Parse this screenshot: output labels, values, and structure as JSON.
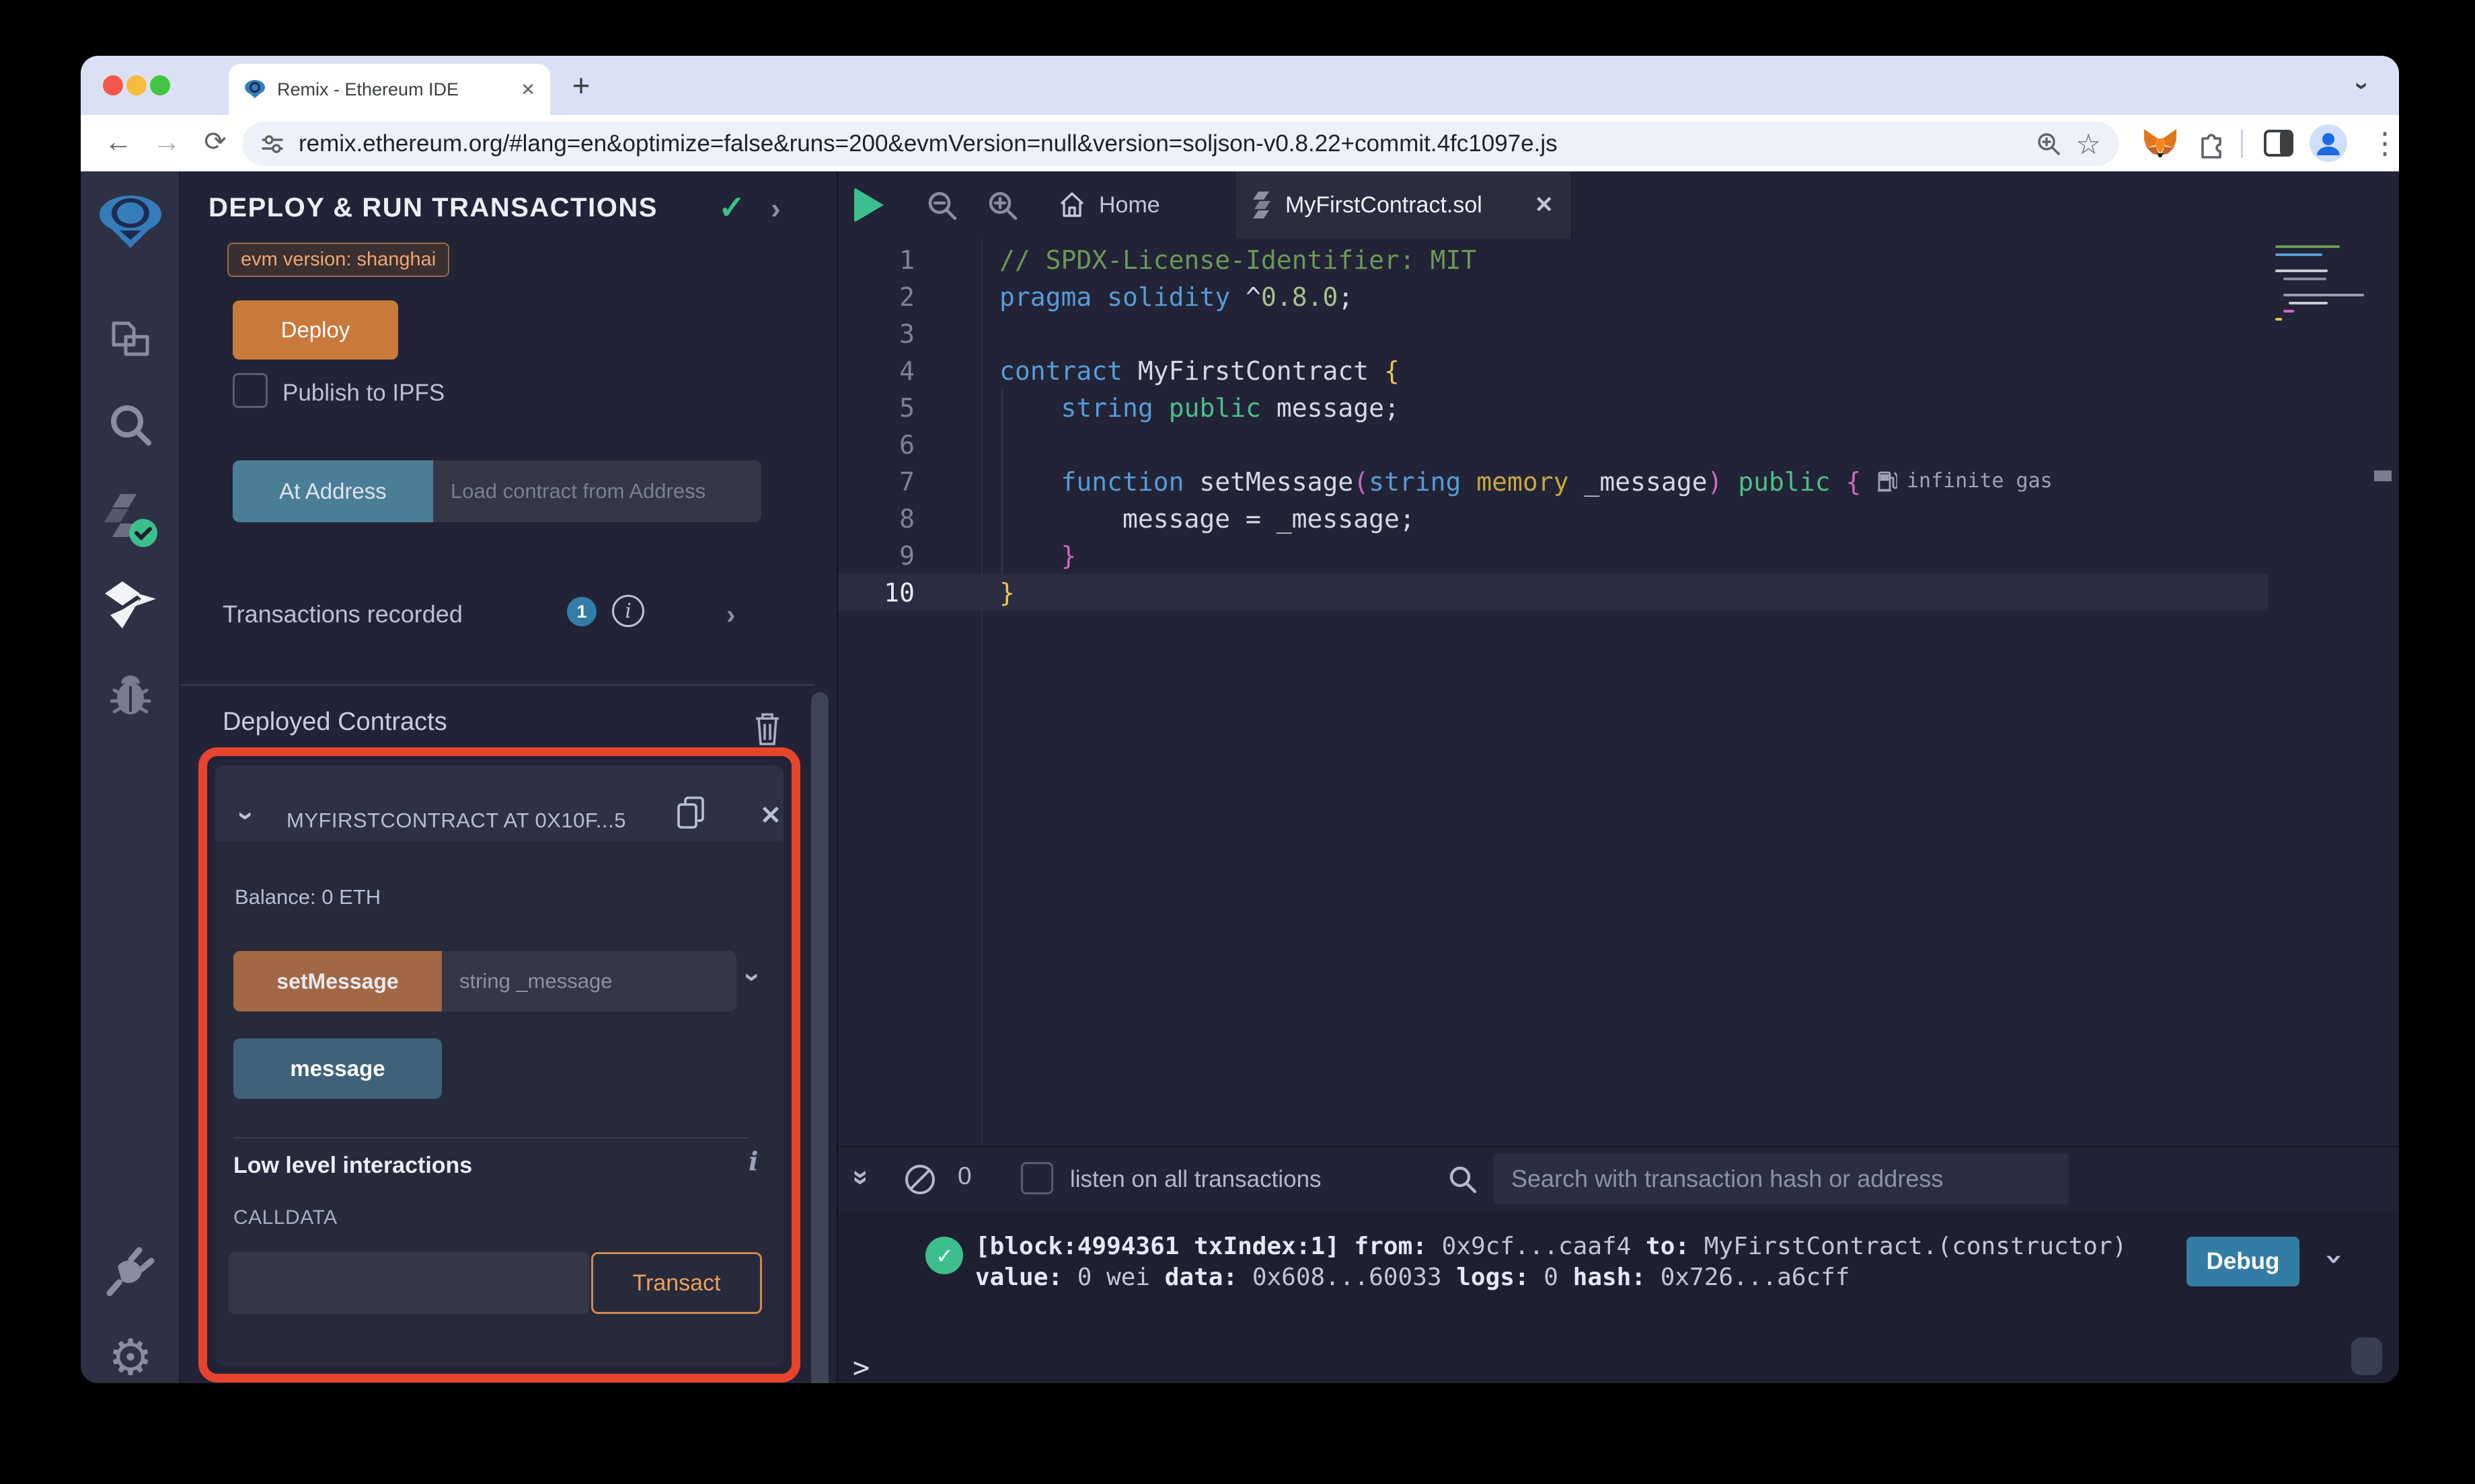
{
  "browser": {
    "tab_title": "Remix - Ethereum IDE",
    "url": "remix.ethereum.org/#lang=en&optimize=false&runs=200&evmVersion=null&version=soljson-v0.8.22+commit.4fc1097e.js"
  },
  "icons": {
    "close": "✕",
    "plus": "+",
    "kebab": "⋮",
    "chevron": "›",
    "double_chevron": "»",
    "back": "←",
    "forward": "→",
    "reload": "⟳",
    "check": "✓",
    "info": "i",
    "star": "☆",
    "gear": "⚙"
  },
  "side_panel": {
    "title": "DEPLOY & RUN TRANSACTIONS",
    "evm_badge": "evm version: shanghai",
    "deploy_button": "Deploy",
    "publish_checkbox_label": "Publish to IPFS",
    "at_address_button": "At Address",
    "at_address_placeholder": "Load contract from Address",
    "transactions_recorded_label": "Transactions recorded",
    "transactions_count": "1",
    "deployed_contracts_label": "Deployed Contracts",
    "contract_card": {
      "title": "MYFIRSTCONTRACT AT 0X10F...5",
      "balance": "Balance: 0 ETH",
      "set_message_button": "setMessage",
      "set_message_placeholder": "string _message",
      "message_button": "message",
      "low_level_label": "Low level interactions",
      "calldata_label": "CALLDATA",
      "transact_button": "Transact"
    }
  },
  "editor": {
    "tabs": [
      {
        "label": "Home"
      },
      {
        "label": "MyFirstContract.sol"
      }
    ],
    "gas_annotation": "infinite gas",
    "lines": [
      {
        "n": "1",
        "tokens": [
          [
            "comment",
            "// SPDX-License-Identifier: MIT"
          ]
        ]
      },
      {
        "n": "2",
        "tokens": [
          [
            "keyword",
            "pragma"
          ],
          [
            "plain",
            " "
          ],
          [
            "keyword",
            "solidity"
          ],
          [
            "plain",
            " ^"
          ],
          [
            "number",
            "0.8.0"
          ],
          [
            "plain",
            ";"
          ]
        ]
      },
      {
        "n": "3",
        "tokens": []
      },
      {
        "n": "4",
        "tokens": [
          [
            "keyword",
            "contract"
          ],
          [
            "plain",
            " MyFirstContract "
          ],
          [
            "yellow",
            "{"
          ]
        ]
      },
      {
        "n": "5",
        "tokens": [
          [
            "plain",
            "    "
          ],
          [
            "keyword",
            "string"
          ],
          [
            "plain",
            " "
          ],
          [
            "green",
            "public"
          ],
          [
            "plain",
            " message;"
          ]
        ]
      },
      {
        "n": "6",
        "tokens": []
      },
      {
        "n": "7",
        "tokens": [
          [
            "plain",
            "    "
          ],
          [
            "keyword",
            "function"
          ],
          [
            "plain",
            " setMessage"
          ],
          [
            "magenta",
            "("
          ],
          [
            "keyword",
            "string"
          ],
          [
            "plain",
            " "
          ],
          [
            "gold",
            "memory"
          ],
          [
            "plain",
            " _message"
          ],
          [
            "magenta",
            ")"
          ],
          [
            "plain",
            " "
          ],
          [
            "green",
            "public"
          ],
          [
            "plain",
            " "
          ],
          [
            "magenta",
            "{"
          ]
        ]
      },
      {
        "n": "8",
        "tokens": [
          [
            "plain",
            "        message = _message;"
          ]
        ]
      },
      {
        "n": "9",
        "tokens": [
          [
            "plain",
            "    "
          ],
          [
            "magenta",
            "}"
          ]
        ]
      },
      {
        "n": "10",
        "tokens": [
          [
            "yellow",
            "}"
          ]
        ],
        "active": true
      }
    ]
  },
  "terminal": {
    "pending_count": "0",
    "listen_label": "listen on all transactions",
    "search_placeholder": "Search with transaction hash or address",
    "debug_button": "Debug",
    "prompt": ">",
    "log_lines": [
      {
        "tokens": [
          [
            "b",
            "[block:4994361 txIndex:1]"
          ],
          [
            "r",
            " "
          ],
          [
            "b",
            "from:"
          ],
          [
            "r",
            " 0x9cf...caaf4 "
          ],
          [
            "b",
            "to:"
          ],
          [
            "r",
            " MyFirstContract.(constructor)"
          ]
        ]
      },
      {
        "tokens": [
          [
            "b",
            "value:"
          ],
          [
            "r",
            " 0 wei "
          ],
          [
            "b",
            "data:"
          ],
          [
            "r",
            " 0x608...60033 "
          ],
          [
            "b",
            "logs:"
          ],
          [
            "r",
            " 0 "
          ],
          [
            "b",
            "hash:"
          ],
          [
            "r",
            " 0x726...a6cff"
          ]
        ]
      }
    ]
  },
  "colors": {
    "mac-red": "#f5574c",
    "mac-yellow": "#f6bc3e",
    "mac-green": "#43c645",
    "accent-orange": "#c9793c",
    "btn-orange-muted": "#a26744",
    "accent-teal": "#4a7e96",
    "btn-steel": "#3f6279",
    "debug-blue": "#337ca6",
    "annotation-red": "#e8432c",
    "success-green": "#3cbf8c",
    "badge-blue": "#337da8",
    "code-comment": "#6a9955",
    "code-keyword": "#569cd6",
    "code-gold": "#c9a63f",
    "code-green": "#4dbe8b",
    "code-magenta": "#cf68c1",
    "code-yellow": "#e8c555",
    "code-number": "#a8c08c",
    "code-plain": "#d6d8e4"
  }
}
